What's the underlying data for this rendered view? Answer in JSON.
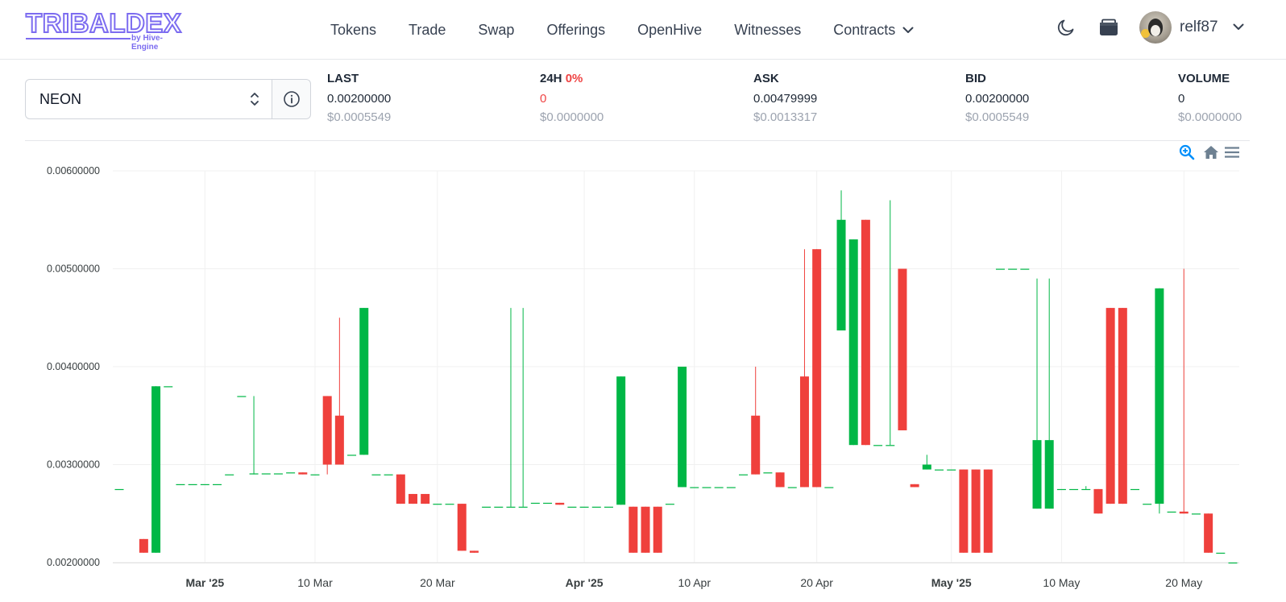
{
  "header": {
    "logo_text": "TRIBALDEX",
    "logo_sub": "by Hive-Engine",
    "nav": [
      "Tokens",
      "Trade",
      "Swap",
      "Offerings",
      "OpenHive",
      "Witnesses"
    ],
    "contracts_label": "Contracts",
    "username": "relf87"
  },
  "ticker": {
    "token": "NEON",
    "last": {
      "label": "LAST",
      "value": "0.00200000",
      "usd": "$0.0005549"
    },
    "change": {
      "label": "24H",
      "pct": "0%",
      "value": "0",
      "usd": "$0.0000000"
    },
    "ask": {
      "label": "ASK",
      "value": "0.00479999",
      "usd": "$0.0013317"
    },
    "bid": {
      "label": "BID",
      "value": "0.00200000",
      "usd": "$0.0005549"
    },
    "volume": {
      "label": "VOLUME",
      "value": "0",
      "usd": "$0.0000000"
    }
  },
  "colors": {
    "up": "#00b746",
    "down": "#ef403c",
    "accent": "#7c6cf0",
    "zoom": "#008ffb"
  },
  "chart_data": {
    "type": "candlestick",
    "y_ticks": [
      "0.00600000",
      "0.00500000",
      "0.00400000",
      "0.00300000",
      "0.00200000"
    ],
    "ylim": [
      0.002,
      0.006
    ],
    "x_range": [
      "2025-02-22",
      "2025-05-24"
    ],
    "x_ticks": [
      {
        "date": "2025-03-01",
        "label": "Mar '25",
        "bold": true
      },
      {
        "date": "2025-03-10",
        "label": "10 Mar",
        "bold": false
      },
      {
        "date": "2025-03-20",
        "label": "20 Mar",
        "bold": false
      },
      {
        "date": "2025-04-01",
        "label": "Apr '25",
        "bold": true
      },
      {
        "date": "2025-04-10",
        "label": "10 Apr",
        "bold": false
      },
      {
        "date": "2025-04-20",
        "label": "20 Apr",
        "bold": false
      },
      {
        "date": "2025-05-01",
        "label": "May '25",
        "bold": true
      },
      {
        "date": "2025-05-10",
        "label": "10 May",
        "bold": false
      },
      {
        "date": "2025-05-20",
        "label": "20 May",
        "bold": false
      }
    ],
    "candles": [
      {
        "date": "2025-02-22",
        "open": 0.00275,
        "high": 0.00275,
        "low": 0.00275,
        "close": 0.00275
      },
      {
        "date": "2025-02-24",
        "open": 0.00224,
        "high": 0.00224,
        "low": 0.0021,
        "close": 0.0021
      },
      {
        "date": "2025-02-25",
        "open": 0.0021,
        "high": 0.0038,
        "low": 0.0021,
        "close": 0.0038
      },
      {
        "date": "2025-02-26",
        "open": 0.0038,
        "high": 0.0038,
        "low": 0.0038,
        "close": 0.0038
      },
      {
        "date": "2025-02-27",
        "open": 0.0028,
        "high": 0.0028,
        "low": 0.0028,
        "close": 0.0028
      },
      {
        "date": "2025-02-28",
        "open": 0.0028,
        "high": 0.0028,
        "low": 0.0028,
        "close": 0.0028
      },
      {
        "date": "2025-03-01",
        "open": 0.0028,
        "high": 0.0028,
        "low": 0.0028,
        "close": 0.0028
      },
      {
        "date": "2025-03-02",
        "open": 0.0028,
        "high": 0.0028,
        "low": 0.0028,
        "close": 0.0028
      },
      {
        "date": "2025-03-03",
        "open": 0.0029,
        "high": 0.0029,
        "low": 0.0029,
        "close": 0.0029
      },
      {
        "date": "2025-03-04",
        "open": 0.0037,
        "high": 0.0037,
        "low": 0.0037,
        "close": 0.0037
      },
      {
        "date": "2025-03-05",
        "open": 0.0029,
        "high": 0.0037,
        "low": 0.0029,
        "close": 0.00291
      },
      {
        "date": "2025-03-06",
        "open": 0.00291,
        "high": 0.00291,
        "low": 0.00291,
        "close": 0.00291
      },
      {
        "date": "2025-03-07",
        "open": 0.00291,
        "high": 0.00291,
        "low": 0.00291,
        "close": 0.00291
      },
      {
        "date": "2025-03-08",
        "open": 0.00292,
        "high": 0.00292,
        "low": 0.00292,
        "close": 0.00292
      },
      {
        "date": "2025-03-09",
        "open": 0.00292,
        "high": 0.00292,
        "low": 0.0029,
        "close": 0.0029
      },
      {
        "date": "2025-03-10",
        "open": 0.0029,
        "high": 0.0029,
        "low": 0.0029,
        "close": 0.0029
      },
      {
        "date": "2025-03-11",
        "open": 0.0037,
        "high": 0.0037,
        "low": 0.0029,
        "close": 0.003
      },
      {
        "date": "2025-03-12",
        "open": 0.0035,
        "high": 0.0045,
        "low": 0.003,
        "close": 0.003
      },
      {
        "date": "2025-03-13",
        "open": 0.0031,
        "high": 0.0031,
        "low": 0.0031,
        "close": 0.0031
      },
      {
        "date": "2025-03-14",
        "open": 0.0031,
        "high": 0.0046,
        "low": 0.0031,
        "close": 0.0046
      },
      {
        "date": "2025-03-15",
        "open": 0.0029,
        "high": 0.0029,
        "low": 0.0029,
        "close": 0.0029
      },
      {
        "date": "2025-03-16",
        "open": 0.0029,
        "high": 0.0029,
        "low": 0.0029,
        "close": 0.0029
      },
      {
        "date": "2025-03-17",
        "open": 0.0029,
        "high": 0.0029,
        "low": 0.0026,
        "close": 0.0026
      },
      {
        "date": "2025-03-18",
        "open": 0.0027,
        "high": 0.0027,
        "low": 0.0026,
        "close": 0.0026
      },
      {
        "date": "2025-03-19",
        "open": 0.0027,
        "high": 0.0027,
        "low": 0.0026,
        "close": 0.0026
      },
      {
        "date": "2025-03-20",
        "open": 0.0026,
        "high": 0.0026,
        "low": 0.0026,
        "close": 0.0026
      },
      {
        "date": "2025-03-21",
        "open": 0.0026,
        "high": 0.0026,
        "low": 0.0026,
        "close": 0.0026
      },
      {
        "date": "2025-03-22",
        "open": 0.0026,
        "high": 0.0026,
        "low": 0.00212,
        "close": 0.00212
      },
      {
        "date": "2025-03-23",
        "open": 0.00212,
        "high": 0.00212,
        "low": 0.0021,
        "close": 0.0021
      },
      {
        "date": "2025-03-24",
        "open": 0.00257,
        "high": 0.00257,
        "low": 0.00257,
        "close": 0.00257
      },
      {
        "date": "2025-03-25",
        "open": 0.00257,
        "high": 0.00257,
        "low": 0.00257,
        "close": 0.00257
      },
      {
        "date": "2025-03-26",
        "open": 0.00257,
        "high": 0.0046,
        "low": 0.00257,
        "close": 0.00257
      },
      {
        "date": "2025-03-27",
        "open": 0.00257,
        "high": 0.0046,
        "low": 0.00257,
        "close": 0.00257
      },
      {
        "date": "2025-03-28",
        "open": 0.00261,
        "high": 0.00261,
        "low": 0.00261,
        "close": 0.00261
      },
      {
        "date": "2025-03-29",
        "open": 0.00261,
        "high": 0.00261,
        "low": 0.00261,
        "close": 0.00261
      },
      {
        "date": "2025-03-30",
        "open": 0.00261,
        "high": 0.00261,
        "low": 0.00259,
        "close": 0.00259
      },
      {
        "date": "2025-03-31",
        "open": 0.00257,
        "high": 0.00257,
        "low": 0.00257,
        "close": 0.00257
      },
      {
        "date": "2025-04-01",
        "open": 0.00257,
        "high": 0.00257,
        "low": 0.00257,
        "close": 0.00257
      },
      {
        "date": "2025-04-02",
        "open": 0.00257,
        "high": 0.00257,
        "low": 0.00257,
        "close": 0.00257
      },
      {
        "date": "2025-04-03",
        "open": 0.00257,
        "high": 0.00257,
        "low": 0.00257,
        "close": 0.00257
      },
      {
        "date": "2025-04-04",
        "open": 0.00259,
        "high": 0.0039,
        "low": 0.00259,
        "close": 0.0039
      },
      {
        "date": "2025-04-05",
        "open": 0.00257,
        "high": 0.00257,
        "low": 0.0021,
        "close": 0.0021
      },
      {
        "date": "2025-04-06",
        "open": 0.00257,
        "high": 0.00257,
        "low": 0.0021,
        "close": 0.0021
      },
      {
        "date": "2025-04-07",
        "open": 0.00257,
        "high": 0.00257,
        "low": 0.0021,
        "close": 0.0021
      },
      {
        "date": "2025-04-08",
        "open": 0.0026,
        "high": 0.0026,
        "low": 0.0026,
        "close": 0.0026
      },
      {
        "date": "2025-04-09",
        "open": 0.00277,
        "high": 0.004,
        "low": 0.00277,
        "close": 0.004
      },
      {
        "date": "2025-04-10",
        "open": 0.00277,
        "high": 0.00277,
        "low": 0.00277,
        "close": 0.00277
      },
      {
        "date": "2025-04-11",
        "open": 0.00277,
        "high": 0.00277,
        "low": 0.00277,
        "close": 0.00277
      },
      {
        "date": "2025-04-12",
        "open": 0.00277,
        "high": 0.00277,
        "low": 0.00277,
        "close": 0.00277
      },
      {
        "date": "2025-04-13",
        "open": 0.00277,
        "high": 0.00277,
        "low": 0.00277,
        "close": 0.00277
      },
      {
        "date": "2025-04-14",
        "open": 0.0029,
        "high": 0.0029,
        "low": 0.0029,
        "close": 0.0029
      },
      {
        "date": "2025-04-15",
        "open": 0.0035,
        "high": 0.004,
        "low": 0.0029,
        "close": 0.0029
      },
      {
        "date": "2025-04-16",
        "open": 0.00292,
        "high": 0.00292,
        "low": 0.00292,
        "close": 0.00292
      },
      {
        "date": "2025-04-17",
        "open": 0.00292,
        "high": 0.00292,
        "low": 0.00277,
        "close": 0.00277
      },
      {
        "date": "2025-04-18",
        "open": 0.00277,
        "high": 0.00277,
        "low": 0.00277,
        "close": 0.00277
      },
      {
        "date": "2025-04-19",
        "open": 0.0039,
        "high": 0.0052,
        "low": 0.00277,
        "close": 0.00277
      },
      {
        "date": "2025-04-20",
        "open": 0.0052,
        "high": 0.0052,
        "low": 0.00277,
        "close": 0.00277
      },
      {
        "date": "2025-04-21",
        "open": 0.00277,
        "high": 0.00277,
        "low": 0.00277,
        "close": 0.00277
      },
      {
        "date": "2025-04-22",
        "open": 0.00437,
        "high": 0.0058,
        "low": 0.00437,
        "close": 0.0055
      },
      {
        "date": "2025-04-23",
        "open": 0.0032,
        "high": 0.0053,
        "low": 0.0032,
        "close": 0.0053
      },
      {
        "date": "2025-04-24",
        "open": 0.0055,
        "high": 0.0055,
        "low": 0.0032,
        "close": 0.0032
      },
      {
        "date": "2025-04-25",
        "open": 0.0032,
        "high": 0.0032,
        "low": 0.0032,
        "close": 0.0032
      },
      {
        "date": "2025-04-26",
        "open": 0.0032,
        "high": 0.0057,
        "low": 0.0032,
        "close": 0.0032
      },
      {
        "date": "2025-04-27",
        "open": 0.005,
        "high": 0.005,
        "low": 0.00335,
        "close": 0.00335
      },
      {
        "date": "2025-04-28",
        "open": 0.0028,
        "high": 0.0028,
        "low": 0.00277,
        "close": 0.00277
      },
      {
        "date": "2025-04-29",
        "open": 0.00295,
        "high": 0.0031,
        "low": 0.00295,
        "close": 0.003
      },
      {
        "date": "2025-04-30",
        "open": 0.00295,
        "high": 0.00295,
        "low": 0.00295,
        "close": 0.00295
      },
      {
        "date": "2025-05-01",
        "open": 0.00295,
        "high": 0.00295,
        "low": 0.00295,
        "close": 0.00295
      },
      {
        "date": "2025-05-02",
        "open": 0.00295,
        "high": 0.00295,
        "low": 0.0021,
        "close": 0.0021
      },
      {
        "date": "2025-05-03",
        "open": 0.00295,
        "high": 0.00295,
        "low": 0.0021,
        "close": 0.0021
      },
      {
        "date": "2025-05-04",
        "open": 0.00295,
        "high": 0.00295,
        "low": 0.0021,
        "close": 0.0021
      },
      {
        "date": "2025-05-05",
        "open": 0.005,
        "high": 0.005,
        "low": 0.005,
        "close": 0.005
      },
      {
        "date": "2025-05-06",
        "open": 0.005,
        "high": 0.005,
        "low": 0.005,
        "close": 0.005
      },
      {
        "date": "2025-05-07",
        "open": 0.005,
        "high": 0.005,
        "low": 0.005,
        "close": 0.005
      },
      {
        "date": "2025-05-08",
        "open": 0.00255,
        "high": 0.0049,
        "low": 0.00255,
        "close": 0.00325
      },
      {
        "date": "2025-05-09",
        "open": 0.00255,
        "high": 0.0049,
        "low": 0.00255,
        "close": 0.00325
      },
      {
        "date": "2025-05-10",
        "open": 0.00275,
        "high": 0.00275,
        "low": 0.00275,
        "close": 0.00275
      },
      {
        "date": "2025-05-11",
        "open": 0.00275,
        "high": 0.00275,
        "low": 0.00275,
        "close": 0.00275
      },
      {
        "date": "2025-05-12",
        "open": 0.00275,
        "high": 0.00278,
        "low": 0.00275,
        "close": 0.00275
      },
      {
        "date": "2025-05-13",
        "open": 0.00275,
        "high": 0.00275,
        "low": 0.0025,
        "close": 0.0025
      },
      {
        "date": "2025-05-14",
        "open": 0.0046,
        "high": 0.0046,
        "low": 0.0026,
        "close": 0.0026
      },
      {
        "date": "2025-05-15",
        "open": 0.0046,
        "high": 0.0046,
        "low": 0.0026,
        "close": 0.0026
      },
      {
        "date": "2025-05-16",
        "open": 0.00275,
        "high": 0.00275,
        "low": 0.00275,
        "close": 0.00275
      },
      {
        "date": "2025-05-17",
        "open": 0.0026,
        "high": 0.0026,
        "low": 0.0026,
        "close": 0.0026
      },
      {
        "date": "2025-05-18",
        "open": 0.0026,
        "high": 0.0048,
        "low": 0.0025,
        "close": 0.0048
      },
      {
        "date": "2025-05-19",
        "open": 0.00252,
        "high": 0.00252,
        "low": 0.00252,
        "close": 0.00252
      },
      {
        "date": "2025-05-20",
        "open": 0.00252,
        "high": 0.005,
        "low": 0.0025,
        "close": 0.0025
      },
      {
        "date": "2025-05-21",
        "open": 0.0025,
        "high": 0.0025,
        "low": 0.0025,
        "close": 0.0025
      },
      {
        "date": "2025-05-22",
        "open": 0.0025,
        "high": 0.0025,
        "low": 0.0021,
        "close": 0.0021
      },
      {
        "date": "2025-05-23",
        "open": 0.0021,
        "high": 0.0021,
        "low": 0.0021,
        "close": 0.0021
      },
      {
        "date": "2025-05-24",
        "open": 0.002,
        "high": 0.002,
        "low": 0.002,
        "close": 0.002
      }
    ]
  }
}
